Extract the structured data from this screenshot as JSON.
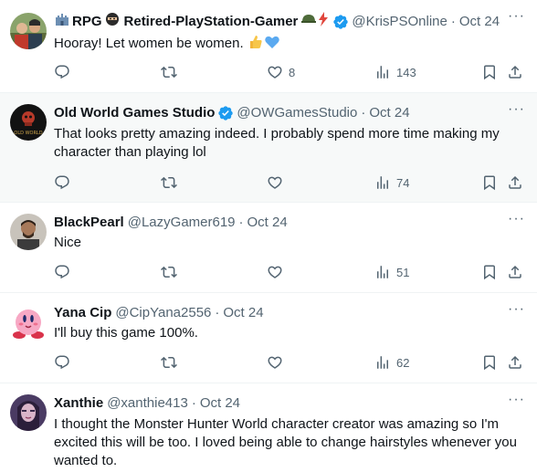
{
  "tweets": [
    {
      "name": "RPG",
      "name2": "Retired-PlayStation-Gamer",
      "handle": "@KrisPSOnline",
      "time": "Oct 24",
      "text": "Hooray! Let women be women.",
      "replies": "",
      "reposts": "",
      "likes": "8",
      "views": "143"
    },
    {
      "name": "Old World Games Studio",
      "handle": "@OWGamesStudio",
      "time": "Oct 24",
      "avatar_text": "OLD WORLD",
      "text": "That looks pretty amazing indeed. I probably spend more time making my character than playing lol",
      "replies": "",
      "reposts": "",
      "likes": "",
      "views": "74"
    },
    {
      "name": "BlackPearl",
      "handle": "@LazyGamer619",
      "time": "Oct 24",
      "text": "Nice",
      "replies": "",
      "reposts": "",
      "likes": "",
      "views": "51"
    },
    {
      "name": "Yana Cip",
      "handle": "@CipYana2556",
      "time": "Oct 24",
      "text": "I'll buy this game 100%.",
      "replies": "",
      "reposts": "",
      "likes": "",
      "views": "62"
    },
    {
      "name": "Xanthie",
      "handle": "@xanthie413",
      "time": "Oct 24",
      "text": "I thought the Monster Hunter World character creator was amazing so I'm excited this will be too. I loved being able to change hairstyles whenever you wanted to."
    }
  ],
  "colors": {
    "verified": "#1d9bf0",
    "muted": "#536471",
    "text": "#0f1419"
  }
}
